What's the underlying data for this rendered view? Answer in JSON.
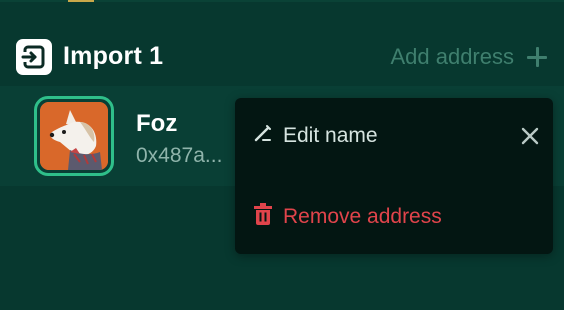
{
  "header": {
    "title": "Import 1",
    "add_address_label": "Add address",
    "icon": "import-icon"
  },
  "account": {
    "name": "Foz",
    "address": "0x487a...",
    "avatar": "dog-avatar"
  },
  "menu": {
    "edit_label": "Edit name",
    "remove_label": "Remove address",
    "close_icon": "close-icon"
  },
  "colors": {
    "background": "#07382f",
    "row_background": "#093f35",
    "menu_background": "#031612",
    "accent": "#2fbf8a",
    "danger": "#e0444b",
    "muted": "#3f7f6e"
  }
}
